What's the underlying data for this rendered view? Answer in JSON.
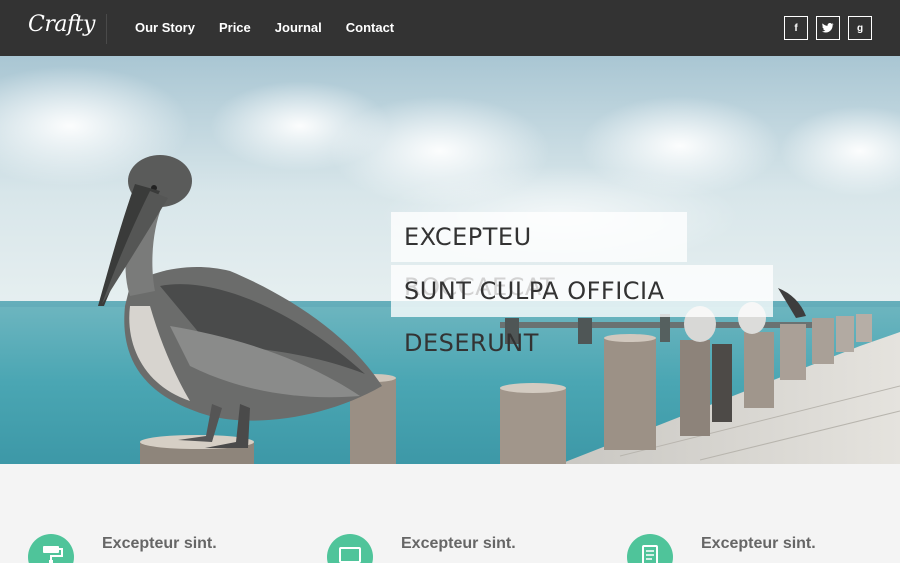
{
  "nav": {
    "logo": "Crafty",
    "links": [
      "Our Story",
      "Price",
      "Journal",
      "Contact"
    ],
    "social": [
      {
        "icon": "facebook-icon",
        "glyph": "f"
      },
      {
        "icon": "twitter-icon",
        "glyph": "t"
      },
      {
        "icon": "google-plus-icon",
        "glyph": "g"
      }
    ]
  },
  "hero": {
    "headline_line1": "EXCEPTEU ROCCAECAT",
    "headline_line2": "SUNT CULPA OFFICIA DESERUNT"
  },
  "features": [
    {
      "title": "Excepteur sint.",
      "icon": "paint-roller-icon"
    },
    {
      "title": "Excepteur sint.",
      "icon": "monitor-icon"
    },
    {
      "title": "Excepteur sint.",
      "icon": "document-icon"
    }
  ],
  "colors": {
    "nav_bg": "#333333",
    "accent": "#4fc49a",
    "feature_title": "#666666",
    "page_bg": "#f4f4f4"
  }
}
